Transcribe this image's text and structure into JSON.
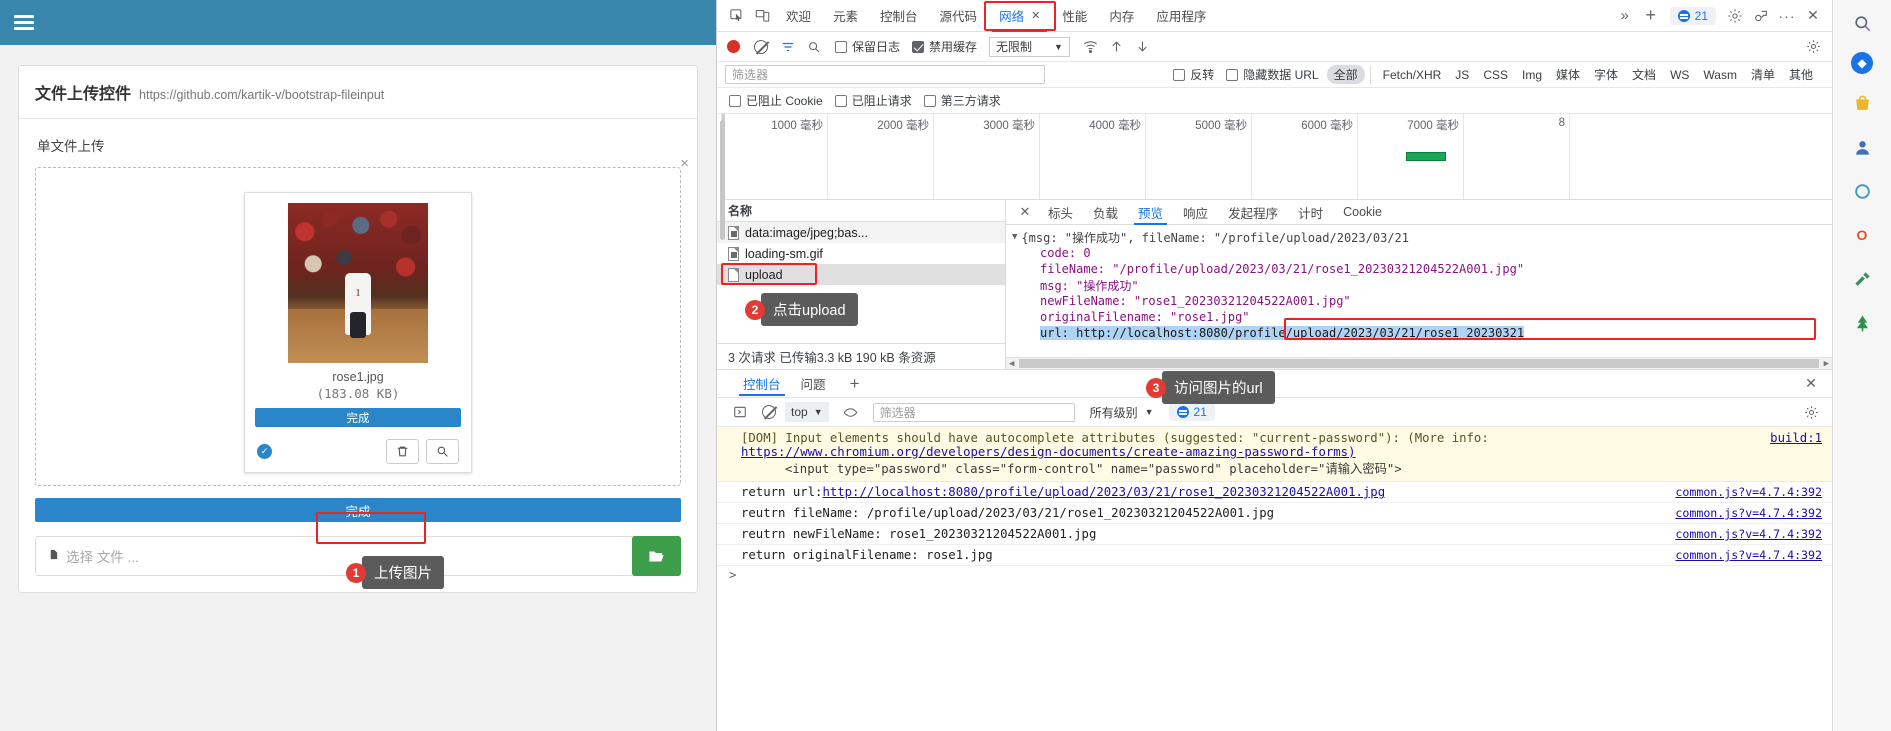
{
  "browser_page": {
    "navbar": {
      "menu_icon": "hamburger-icon"
    },
    "panel": {
      "title": "文件上传控件",
      "url": "https://github.com/kartik-v/bootstrap-fileinput",
      "section_label": "单文件上传",
      "close_icon": "×",
      "preview": {
        "file_name": "rose1.jpg",
        "file_size": "(183.08 KB)",
        "progress_label": "完成",
        "check_icon": "check-circle-icon",
        "delete_icon": "trash-icon",
        "zoom_icon": "magnifier-icon"
      },
      "upload_button_label": "完成",
      "file_caption_placeholder": "选择 文件 ...",
      "browse_icon": "folder-open-icon"
    },
    "callouts": [
      {
        "num": "1",
        "text": "上传图片"
      },
      {
        "num": "2",
        "text": "点击upload"
      },
      {
        "num": "3",
        "text": "访问图片的url"
      }
    ]
  },
  "devtools": {
    "tabbar": {
      "inspect_icon": "inspect-cursor-icon",
      "device_icon": "device-toolbar-icon",
      "tabs": [
        {
          "label": "欢迎",
          "active": false
        },
        {
          "label": "元素",
          "active": false
        },
        {
          "label": "控制台",
          "active": false
        },
        {
          "label": "源代码",
          "active": false
        },
        {
          "label": "网络",
          "active": true,
          "closable": "✕"
        },
        {
          "label": "性能",
          "active": false
        },
        {
          "label": "内存",
          "active": false
        },
        {
          "label": "应用程序",
          "active": false
        }
      ],
      "more_icon": "»",
      "add_icon": "+",
      "issues_count": "21",
      "settings_icon": "gear-icon",
      "customize_icon": "devices-icon",
      "kebab_icon": "···",
      "close_icon": "✕"
    },
    "toolbar": {
      "record_icon": "record-stop-icon",
      "clear_icon": "clear-icon",
      "filter_icon": "filter-icon",
      "search_icon": "search-icon",
      "preserve_log": "保留日志",
      "disable_cache": "禁用缓存",
      "throttle_value": "无限制",
      "wifi_icon": "network-conditions-icon",
      "import_icon": "import-har-icon",
      "export_icon": "export-har-icon",
      "settings_icon": "gear-icon"
    },
    "filterbar": {
      "filter_placeholder": "筛选器",
      "invert": "反转",
      "hide_data_urls": "隐藏数据 URL",
      "types": [
        "全部",
        "Fetch/XHR",
        "JS",
        "CSS",
        "Img",
        "媒体",
        "字体",
        "文档",
        "WS",
        "Wasm",
        "清单",
        "其他"
      ],
      "active_type": "全部"
    },
    "blockbar": {
      "blocked_cookies": "已阻止 Cookie",
      "blocked_requests": "已阻止请求",
      "third_party": "第三方请求"
    },
    "overview": {
      "ticks": [
        "1000 毫秒",
        "2000 毫秒",
        "3000 毫秒",
        "4000 毫秒",
        "5000 毫秒",
        "6000 毫秒",
        "7000 毫秒",
        "8"
      ]
    },
    "network_list": {
      "header": "名称",
      "rows": [
        {
          "name": "data:image/jpeg;bas...",
          "icon": "image-file-icon"
        },
        {
          "name": "loading-sm.gif",
          "icon": "image-file-icon"
        },
        {
          "name": "upload",
          "icon": "document-file-icon",
          "selected": true
        }
      ],
      "footer": "3 次请求  已传输3.3 kB  190 kB 条资源"
    },
    "detail": {
      "close_icon": "✕",
      "subtabs": [
        {
          "label": "标头",
          "active": false
        },
        {
          "label": "负载",
          "active": false
        },
        {
          "label": "预览",
          "active": true
        },
        {
          "label": "响应",
          "active": false
        },
        {
          "label": "发起程序",
          "active": false
        },
        {
          "label": "计时",
          "active": false
        },
        {
          "label": "Cookie",
          "active": false
        }
      ],
      "json_lines": [
        "{msg: \"操作成功\", fileName: \"/profile/upload/2023/03/21",
        "code: 0",
        "fileName: \"/profile/upload/2023/03/21/rose1_20230321204522A001.jpg\"",
        "msg: \"操作成功\"",
        "newFileName: \"rose1_20230321204522A001.jpg\"",
        "originalFilename: \"rose1.jpg\"",
        "url: http://localhost:8080/profile/upload/2023/03/21/rose1_20230321"
      ]
    },
    "console": {
      "tabs": [
        {
          "label": "控制台",
          "active": true
        },
        {
          "label": "问题",
          "active": false
        }
      ],
      "add_icon": "+",
      "close_icon": "✕",
      "toolbar": {
        "sidebar_icon": "console-sidebar-icon",
        "clear_icon": "clear-console-icon",
        "context": "top",
        "eye_icon": "live-expression-icon",
        "filter_placeholder": "筛选器",
        "level": "所有级别",
        "issues_count": "21"
      },
      "warning": {
        "text": "[DOM] Input elements should have autocomplete attributes (suggested: \"current-password\"): (More info:",
        "build_link": "build:1",
        "url": "https://www.chromium.org/developers/design-documents/create-amazing-password-forms)",
        "code": "<input type=\"password\" class=\"form-control\" name=\"password\" placeholder=\"请输入密码\">"
      },
      "logs": [
        {
          "text": "return url: ",
          "link": "http://localhost:8080/profile/upload/2023/03/21/rose1_20230321204522A001.jpg",
          "source": "common.js?v=4.7.4:392"
        },
        {
          "text": "reutrn fileName: /profile/upload/2023/03/21/rose1_20230321204522A001.jpg",
          "link": "",
          "source": "common.js?v=4.7.4:392"
        },
        {
          "text": "reutrn newFileName: rose1_20230321204522A001.jpg",
          "link": "",
          "source": "common.js?v=4.7.4:392"
        },
        {
          "text": "return originalFilename: rose1.jpg",
          "link": "",
          "source": "common.js?v=4.7.4:392"
        }
      ],
      "prompt": ">"
    }
  },
  "edge_sidebar": {
    "icons": [
      "search-icon",
      "leaf-icon",
      "shopping-bag-icon",
      "person-icon",
      "settings-ring-icon",
      "office-icon",
      "tools-icon",
      "tree-icon"
    ]
  },
  "colors": {
    "navbar": "#3a87ad",
    "primary": "#2a86c8",
    "accent_red": "#ee2222",
    "green": "#3c9e4a",
    "devtools_blue": "#1a73e8"
  }
}
